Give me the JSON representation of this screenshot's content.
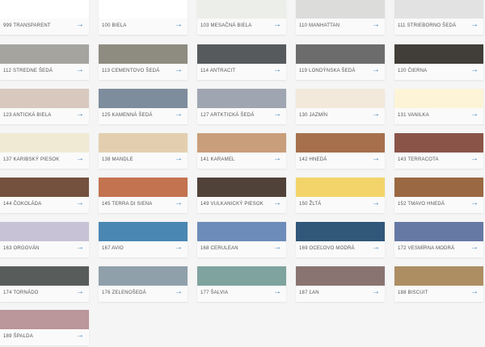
{
  "arrow_glyph": "→",
  "arrow_icon": "arrow-right-icon",
  "accent_color": "#3d7fb8",
  "swatches": [
    {
      "label": "999 TRANSPARENT",
      "color": "#ffffff"
    },
    {
      "label": "100 BIELA",
      "color": "#ffffff"
    },
    {
      "label": "103 MESAČNÁ BIELA",
      "color": "#eceeea"
    },
    {
      "label": "110 MANHATTAN",
      "color": "#dcdcdb"
    },
    {
      "label": "111 STRIEBORNO ŠEDÁ",
      "color": "#e2e2e2"
    },
    {
      "label": "112 STREDNE ŠEDÁ",
      "color": "#a6a49f"
    },
    {
      "label": "113 CEMENTOVO ŠEDÁ",
      "color": "#8e8c81"
    },
    {
      "label": "114 ANTRACIT",
      "color": "#565a5d"
    },
    {
      "label": "119 LONDÝNSKA ŠEDÁ",
      "color": "#6c6c6c"
    },
    {
      "label": "120 ČIERNA",
      "color": "#413d38"
    },
    {
      "label": "123 ANTICKÁ BIELA",
      "color": "#d8c8be"
    },
    {
      "label": "125 KAMENNÁ ŠEDÁ",
      "color": "#7e8d9e"
    },
    {
      "label": "127 ARTKTICKÁ ŠEDÁ",
      "color": "#a0a5b2"
    },
    {
      "label": "130 JAZMÍN",
      "color": "#f3e9db"
    },
    {
      "label": "131 VANILKA",
      "color": "#fdf4d7"
    },
    {
      "label": "137 KARIBSKÝ PIESOK",
      "color": "#f0ead5"
    },
    {
      "label": "138 MANDLE",
      "color": "#e3cfb0"
    },
    {
      "label": "141 KARAMEL",
      "color": "#c99e7a"
    },
    {
      "label": "142 HNEDÁ",
      "color": "#a6704d"
    },
    {
      "label": "143 TERRACOTA",
      "color": "#8a5448"
    },
    {
      "label": "144 ČOKOLÁDA",
      "color": "#74503e"
    },
    {
      "label": "145 TERRA DI SIENA",
      "color": "#c3734f"
    },
    {
      "label": "149 VULKANICKÝ PIESOK",
      "color": "#504139"
    },
    {
      "label": "150 ŽLTÁ",
      "color": "#f2d46a"
    },
    {
      "label": "152 TMAVO HNEDÁ",
      "color": "#9a6842"
    },
    {
      "label": "163 ORGOVÁN",
      "color": "#c8c2d6"
    },
    {
      "label": "167 AVIO",
      "color": "#4a87b2"
    },
    {
      "label": "168 CERULEAN",
      "color": "#6d8cba"
    },
    {
      "label": "169 OCEĽOVO MODRÁ",
      "color": "#315779"
    },
    {
      "label": "172 VESMÍRNA MODRÁ",
      "color": "#6579a4"
    },
    {
      "label": "174 TORNÁDO",
      "color": "#585d5c"
    },
    {
      "label": "176 ZELENOŠEDÁ",
      "color": "#8fa0ab"
    },
    {
      "label": "177 ŠALVIA",
      "color": "#7fa39e"
    },
    {
      "label": "187 ĽAN",
      "color": "#8a7472"
    },
    {
      "label": "188 BISCUIT",
      "color": "#ad8e63"
    },
    {
      "label": "189 ŠPALDA",
      "color": "#bb969a"
    }
  ]
}
